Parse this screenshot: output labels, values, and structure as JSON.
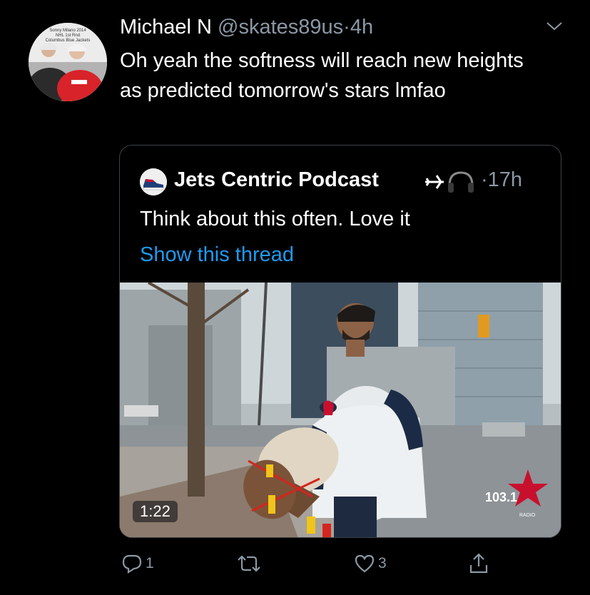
{
  "tweet": {
    "avatar_caption": [
      "Sonny Milano 2014",
      "NHL 1st Rnd",
      "Columbus Blue Jackets"
    ],
    "name": "Michael N",
    "handle": "@skates89us",
    "separator": "·",
    "time": "4h",
    "text": "Oh yeah the softness will reach new heights as predicted tomorrow's stars lmfao"
  },
  "quote": {
    "name": "Jets Centric Podcast",
    "emoji": [
      "airplane-icon",
      "headphones-icon"
    ],
    "separator": "·",
    "time": "17h",
    "text": "Think about this often. Love it",
    "thread_link": "Show this thread",
    "video": {
      "duration": "1:22",
      "station_logo_text": "103.1",
      "station_subtext": "RADIO"
    }
  },
  "actions": {
    "reply_count": "1",
    "retweet_count": "",
    "like_count": "3"
  },
  "colors": {
    "background": "#000000",
    "secondary_text": "#8b98a5",
    "link": "#1d9bf0",
    "border": "#3d4247"
  }
}
